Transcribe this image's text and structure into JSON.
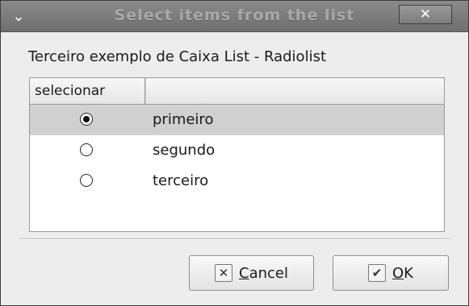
{
  "window": {
    "title": "Select items from the list",
    "menu_icon": "chevron-down-icon",
    "close_icon": "close-icon"
  },
  "caption": "Terceiro exemplo de Caixa List - Radiolist",
  "list": {
    "columns": [
      "selecionar",
      ""
    ],
    "rows": [
      {
        "label": "primeiro",
        "checked": true,
        "highlighted": true
      },
      {
        "label": "segundo",
        "checked": false,
        "highlighted": false
      },
      {
        "label": "terceiro",
        "checked": false,
        "highlighted": false
      }
    ]
  },
  "buttons": {
    "cancel": {
      "mnemonic": "C",
      "rest": "ancel",
      "icon": "close-icon"
    },
    "ok": {
      "mnemonic": "O",
      "rest": "K",
      "icon": "check-icon"
    }
  },
  "colors": {
    "titlebar": "#7a7a7a",
    "selected_row": "#d0d0d0",
    "window_bg": "#ededed"
  }
}
